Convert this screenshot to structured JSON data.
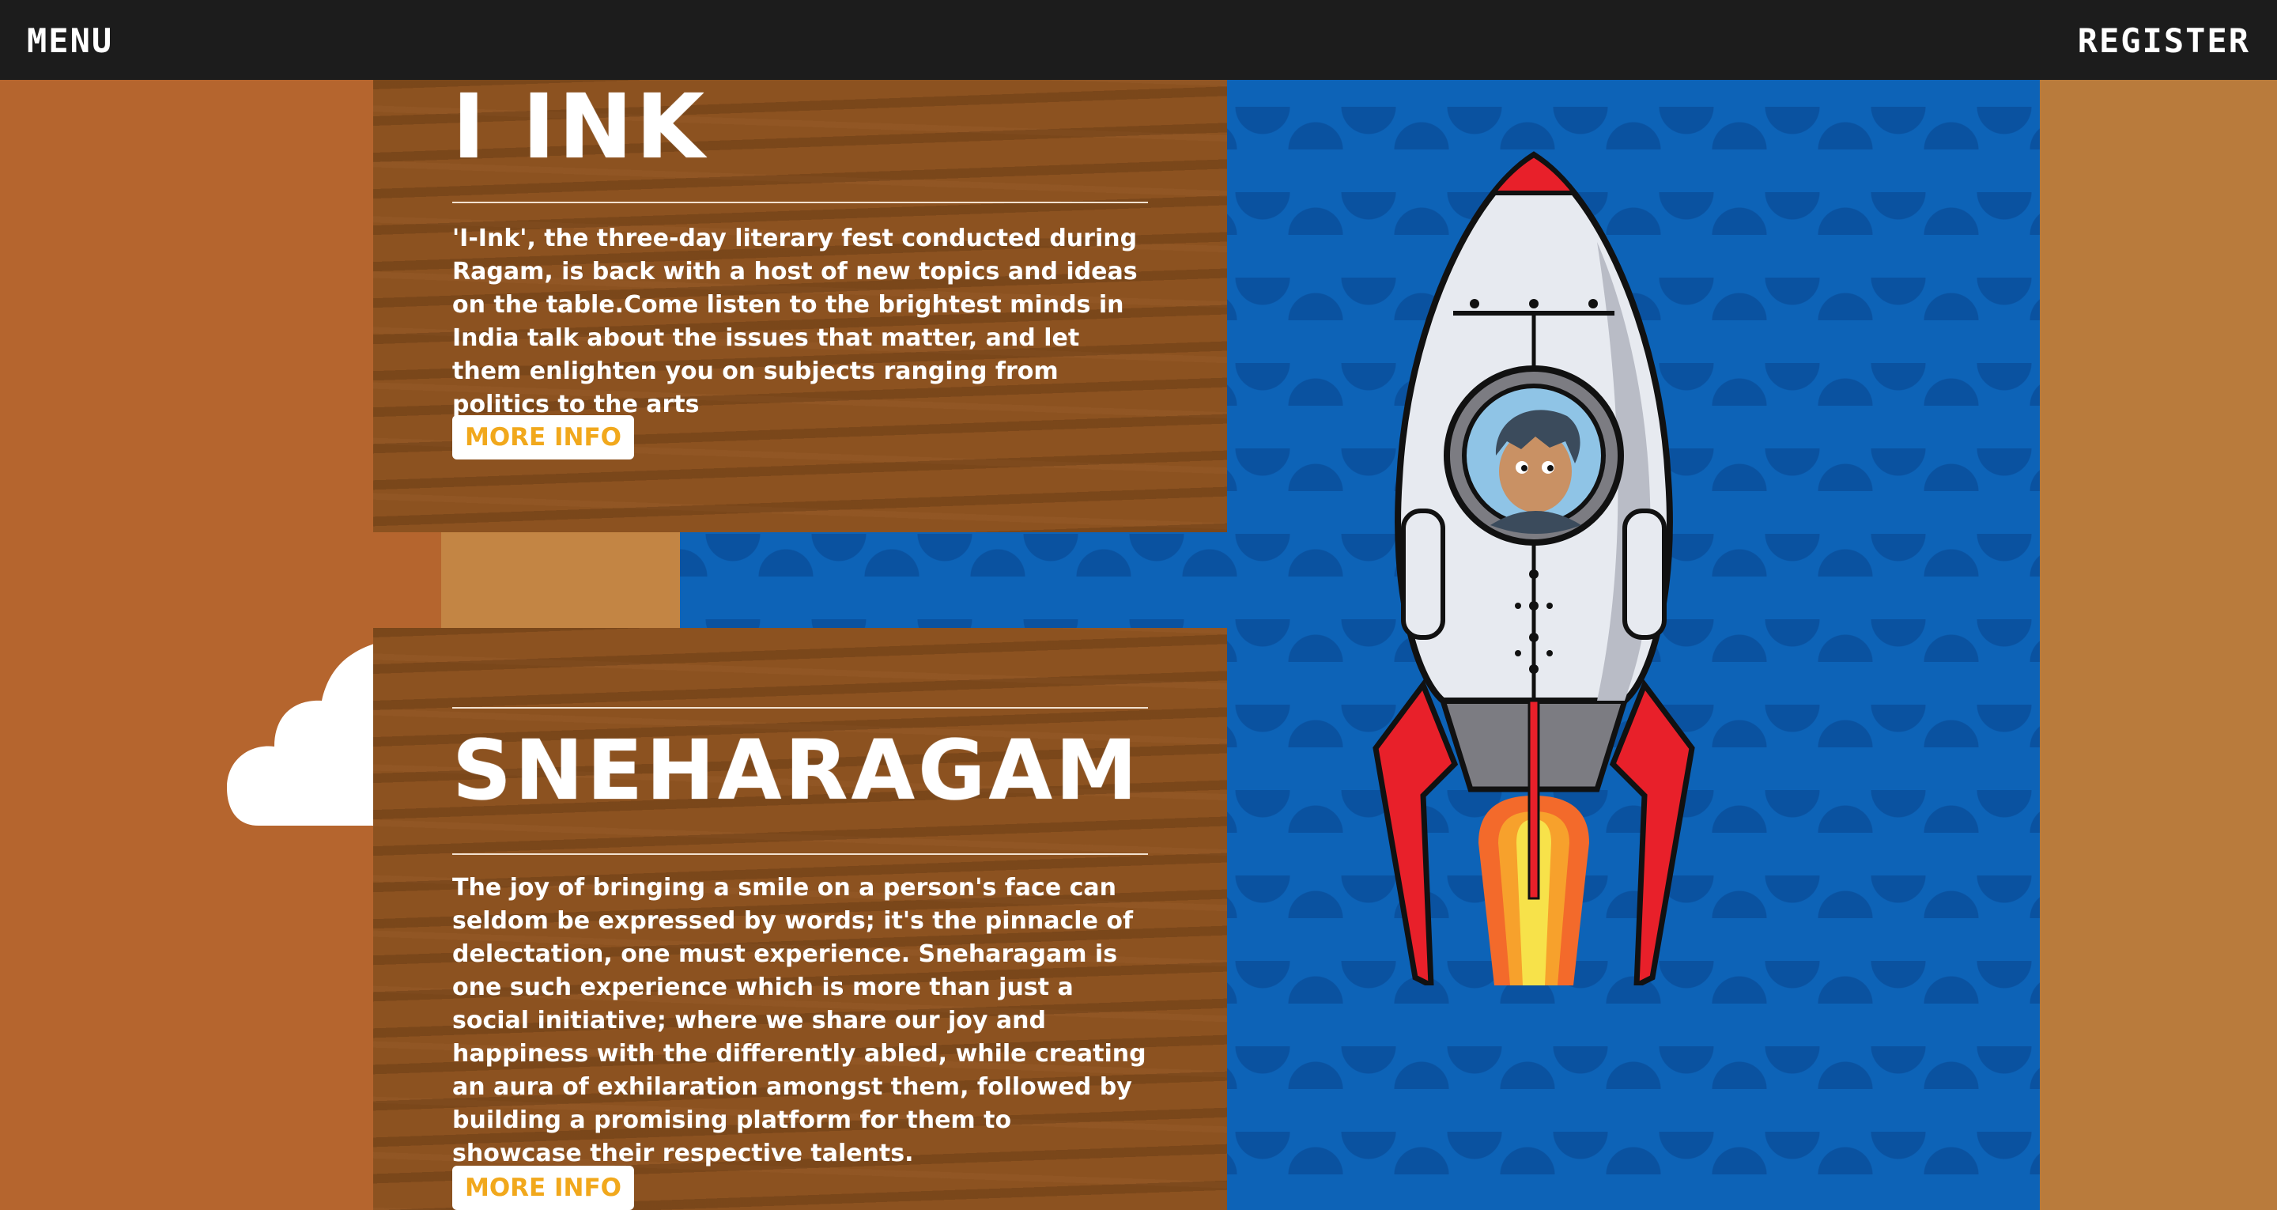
{
  "topbar": {
    "menu_label": "MENU",
    "register_label": "REGISTER"
  },
  "events": [
    {
      "title": "I INK",
      "description": "'I-Ink', the three-day literary fest conducted during Ragam, is back with a host of new topics and ideas on the table.Come listen to the brightest minds in India talk about the issues that matter, and let them enlighten you on subjects ranging from politics to the arts",
      "button_label": "MORE INFO"
    },
    {
      "title": "SNEHARAGAM",
      "description": "The joy of bringing a smile on a person's face can seldom be expressed by words; it's the pinnacle of delectation, one must experience. Sneharagam is one such experience which is more than just a social initiative; where we share our joy and happiness with the differently abled, while creating an aura of exhilaration amongst them, followed by building a promising platform for them to showcase their respective talents.",
      "button_label": "MORE INFO"
    }
  ],
  "colors": {
    "topbar": "#1c1c1c",
    "background": "#b5652e",
    "card": "#8c5220",
    "water": "#0d63b7",
    "button_text": "#f1a81c"
  },
  "icons": {
    "decor_cloud": "cloud-icon",
    "decor_rocket": "rocket-illustration"
  }
}
